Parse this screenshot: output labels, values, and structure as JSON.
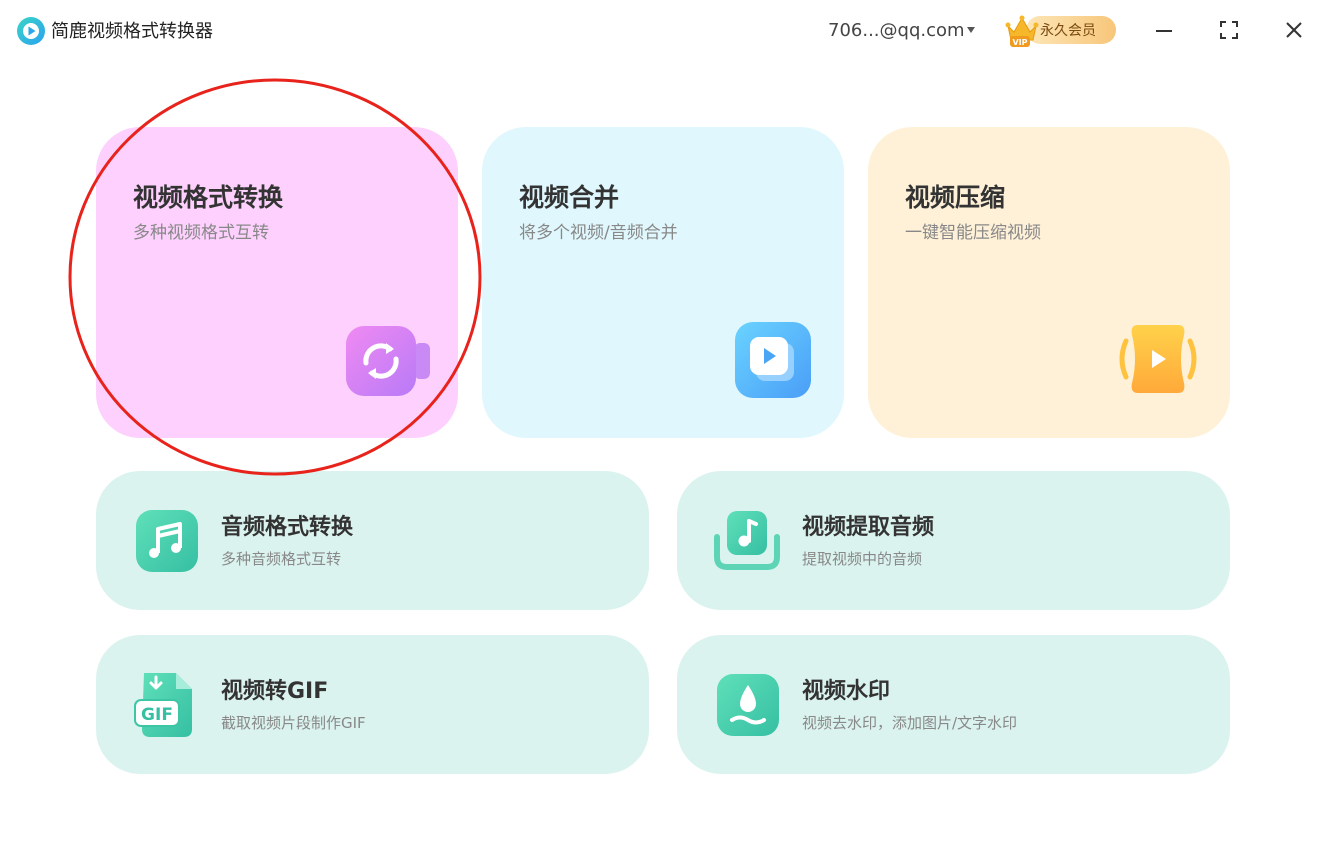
{
  "app": {
    "title": "简鹿视频格式转换器",
    "logo_icon": "play-logo-icon"
  },
  "header": {
    "account": "706...@qq.com",
    "vip_label": "永久会员",
    "vip_badge_text": "VIP"
  },
  "features_large": [
    {
      "title": "视频格式转换",
      "desc": "多种视频格式互转",
      "color": "#fdd0fd",
      "icon": "video-convert-icon"
    },
    {
      "title": "视频合并",
      "desc": "将多个视频/音频合并",
      "color": "#e0f8fd",
      "icon": "video-merge-icon"
    },
    {
      "title": "视频压缩",
      "desc": "一键智能压缩视频",
      "color": "#fef1d8",
      "icon": "video-compress-icon"
    }
  ],
  "features_small": [
    {
      "title": "音频格式转换",
      "desc": "多种音频格式互转",
      "icon": "music-note-icon"
    },
    {
      "title": "视频提取音频",
      "desc": "提取视频中的音频",
      "icon": "extract-audio-icon"
    },
    {
      "title": "视频转GIF",
      "desc": "截取视频片段制作GIF",
      "icon": "gif-icon",
      "icon_text": "GIF"
    },
    {
      "title": "视频水印",
      "desc": "视频去水印，添加图片/文字水印",
      "icon": "watermark-drop-icon"
    }
  ],
  "colors": {
    "small_card_bg": "#dbf3ee",
    "accent_green": "#3fcfa6",
    "annotation_red": "#e8231b"
  }
}
